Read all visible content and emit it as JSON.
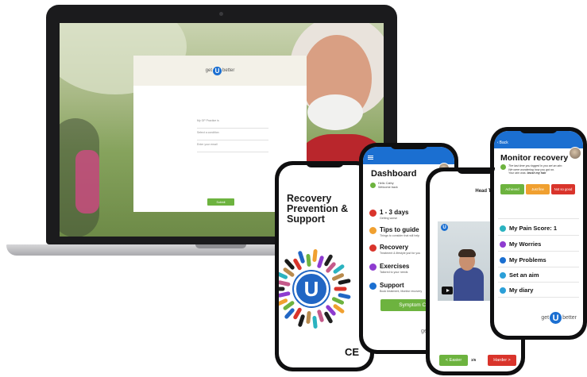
{
  "laptop": {
    "logo": {
      "prefix": "get",
      "letter": "U",
      "suffix": "better"
    },
    "fields": [
      {
        "placeholder": "My GP Practice is"
      },
      {
        "placeholder": "Select a condition"
      },
      {
        "placeholder": "Enter your email"
      }
    ],
    "submit_label": "Submit"
  },
  "phone_recovery": {
    "title_lines": [
      "Recovery",
      "Prevention &",
      "Support"
    ],
    "emblem_letter": "U",
    "ce_mark": "CE"
  },
  "phone_dashboard": {
    "title": "Dashboard",
    "greeting_line1": "Hello Cathy",
    "greeting_line2": "Welcome back",
    "items": [
      {
        "name": "1 - 3 days",
        "sub": "Getting worse",
        "color": "#d9342b"
      },
      {
        "name": "Tips to guide",
        "sub": "Things to consider that will help",
        "color": "#f0a030"
      },
      {
        "name": "Recovery",
        "sub": "Treatment & lifestyle just for you",
        "color": "#d9342b"
      },
      {
        "name": "Exercises",
        "sub": "Tailored to your needs",
        "color": "#8e3bd0"
      },
      {
        "name": "Support",
        "sub": "Book treatment, Monitor recovery",
        "color": "#1b6fd1"
      }
    ],
    "symptom_button": "Symptom Checker",
    "footer": "getUbetter"
  },
  "phone_exercise": {
    "title": "Head Turning",
    "logo_letter": "U",
    "easier_label": "< Easier",
    "counter": "3/6",
    "harder_label": "Harder >"
  },
  "phone_monitor": {
    "back_label": "Back",
    "title": "Monitor recovery",
    "message_line1": "The last time you logged in you set an aim.",
    "message_line2": "We were wondering how you got on.",
    "message_line3_prefix": "Your aim was: ",
    "message_line3_aim": "brush my hair",
    "choices": [
      {
        "label": "Achieved",
        "color": "#6db33f"
      },
      {
        "label": "Just fine",
        "color": "#f0a030"
      },
      {
        "label": "Not so good",
        "color": "#d9342b"
      }
    ],
    "items": [
      {
        "label": "My Pain Score:  1",
        "color": "#2bb3c0"
      },
      {
        "label": "My Worries",
        "color": "#8e3bd0"
      },
      {
        "label": "My Problems",
        "color": "#1b6fd1"
      },
      {
        "label": "Set an aim",
        "color": "#2b9fd8"
      },
      {
        "label": "My diary",
        "color": "#2b9fd8"
      }
    ],
    "logo": {
      "prefix": "get",
      "letter": "U",
      "suffix": "better"
    }
  },
  "colors": {
    "brand_blue": "#1b6fd1",
    "brand_green": "#6db33f",
    "alert_red": "#d9342b"
  }
}
